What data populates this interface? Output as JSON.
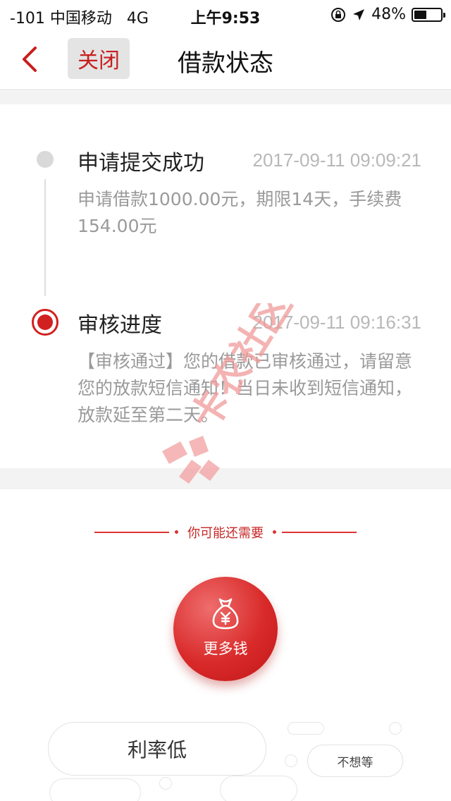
{
  "status_bar": {
    "carrier": "-101 中国移动",
    "network": "4G",
    "time": "上午9:53",
    "battery_text": "48%",
    "battery_level": 0.48
  },
  "nav": {
    "back_icon": "chevron-left-icon",
    "close_label": "关闭",
    "title": "借款状态"
  },
  "timeline": {
    "steps": [
      {
        "title": "申请提交成功",
        "time": "2017-09-11 09:09:21",
        "desc": "申请借款1000.00元，期限14天，手续费154.00元"
      },
      {
        "title": "审核进度",
        "time": "2017-09-11 09:16:31",
        "desc": "【审核通过】您的借款已审核通过，请留意您的放款短信通知！当日未收到短信通知，放款延至第二天。"
      }
    ]
  },
  "suggest": {
    "heading": "你可能还需要",
    "more_money_label": "更多钱",
    "more_money_icon": "money-bag-icon",
    "tags": [
      "利率低",
      "不想等"
    ]
  },
  "watermark_text": "卡农社区",
  "colors": {
    "accent": "#d21f1f",
    "muted_text": "#9a9a9a",
    "time_text": "#b8b8b8"
  }
}
